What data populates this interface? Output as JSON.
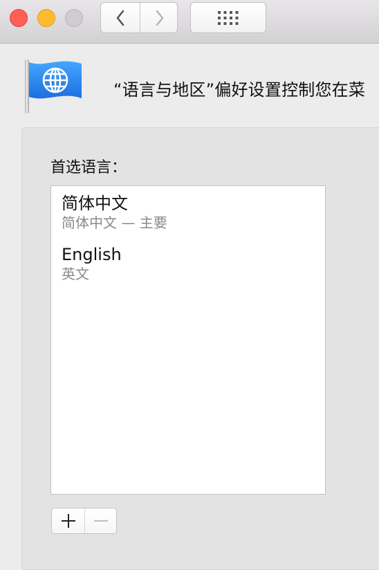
{
  "toolbar": {
    "buttons": {
      "close": "close",
      "minimize": "minimize",
      "zoom": "zoom",
      "back": "back",
      "forward": "forward",
      "show_all": "show all"
    }
  },
  "header": {
    "description": "“语言与地区”偏好设置控制您在菜"
  },
  "preferred_languages": {
    "title": "首选语言：",
    "items": [
      {
        "primary": "简体中文",
        "secondary": "简体中文 — 主要"
      },
      {
        "primary": "English",
        "secondary": "英文"
      }
    ]
  },
  "controls": {
    "add_icon": "plus-icon",
    "remove_icon": "minus-icon"
  },
  "colors": {
    "close": "#fc5f57",
    "minimize": "#fdbc2e",
    "zoom_inactive": "#cfcdcf",
    "globe_blue": "#2c88ee"
  }
}
